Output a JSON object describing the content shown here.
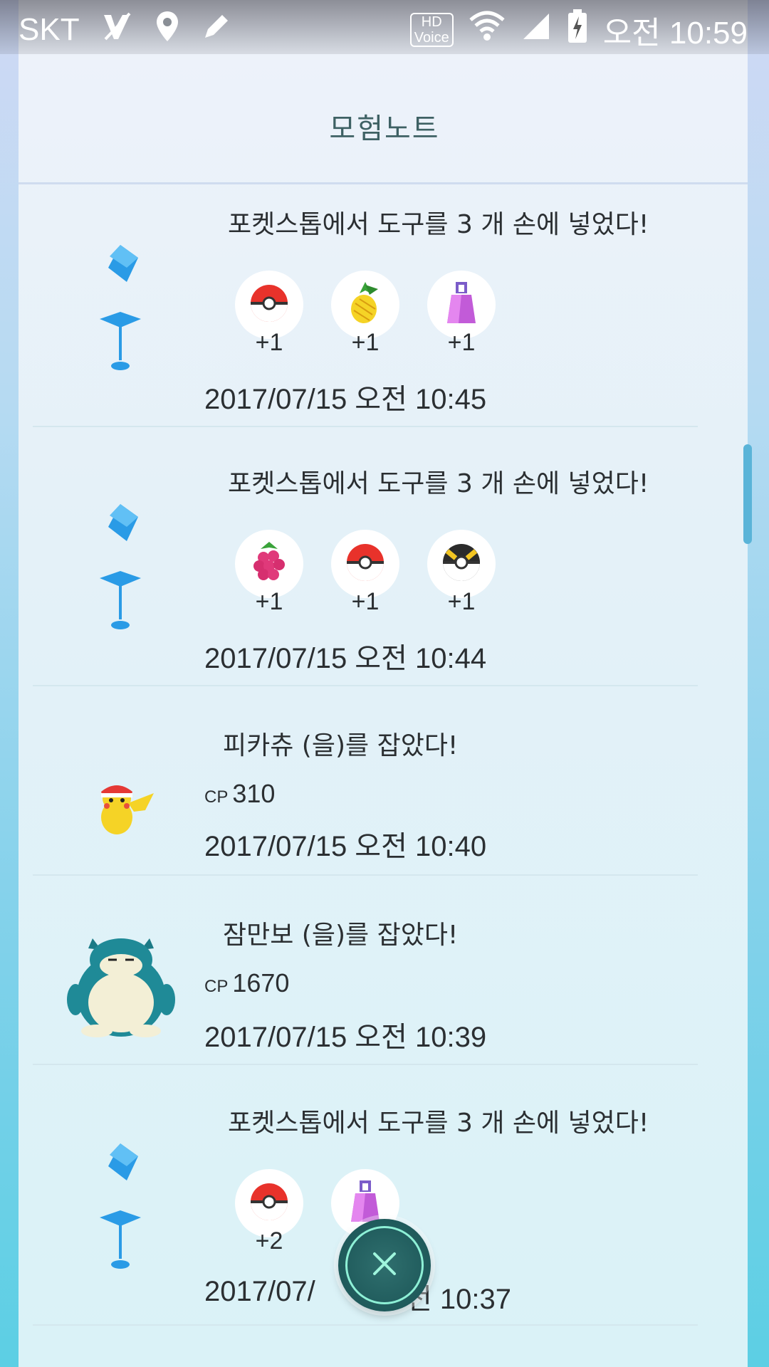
{
  "status_bar": {
    "carrier": "SKT",
    "hd_label_top": "HD",
    "hd_label_bottom": "Voice",
    "time": "오전 10:59"
  },
  "header": {
    "title": "모험노트"
  },
  "entries": [
    {
      "type": "pokestop",
      "title": "포켓스톱에서 도구를 3 개 손에 넣었다!",
      "items": [
        {
          "icon": "pokeball-icon",
          "count": "+1"
        },
        {
          "icon": "pinap-berry-icon",
          "count": "+1"
        },
        {
          "icon": "potion-icon",
          "count": "+1"
        }
      ],
      "date": "2017/07/15 오전 10:45"
    },
    {
      "type": "pokestop",
      "title": "포켓스톱에서 도구를 3 개 손에 넣었다!",
      "items": [
        {
          "icon": "razz-berry-icon",
          "count": "+1"
        },
        {
          "icon": "pokeball-icon",
          "count": "+1"
        },
        {
          "icon": "ultra-ball-icon",
          "count": "+1"
        }
      ],
      "date": "2017/07/15 오전 10:44"
    },
    {
      "type": "catch",
      "title": "피카츄 (을)를 잡았다!",
      "pokemon_icon": "pikachu-icon",
      "cp_label": "CP",
      "cp_value": "310",
      "date": "2017/07/15 오전 10:40"
    },
    {
      "type": "catch",
      "title": "잠만보 (을)를 잡았다!",
      "pokemon_icon": "snorlax-icon",
      "cp_label": "CP",
      "cp_value": "1670",
      "date": "2017/07/15 오전 10:39"
    },
    {
      "type": "pokestop",
      "title": "포켓스톱에서 도구를 3 개 손에 넣었다!",
      "items": [
        {
          "icon": "pokeball-icon",
          "count": "+2"
        },
        {
          "icon": "potion-icon",
          "count": ""
        }
      ],
      "date_left": "2017/07/",
      "date_right": "전 10:37"
    }
  ],
  "close_button": {
    "icon": "close-icon"
  },
  "colors": {
    "title": "#3e6164",
    "pokestop_blue": "#2a9be6",
    "close_bg": "#1f5a5b"
  }
}
